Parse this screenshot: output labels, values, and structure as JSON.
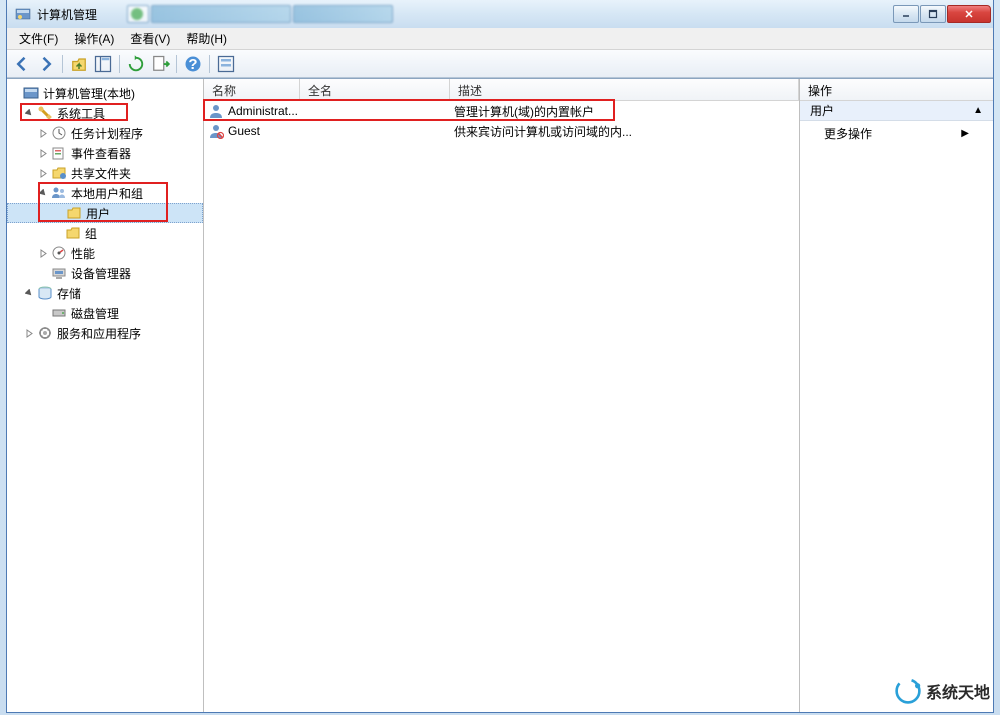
{
  "window": {
    "title": "计算机管理"
  },
  "menubar": [
    {
      "label": "文件(F)"
    },
    {
      "label": "操作(A)"
    },
    {
      "label": "查看(V)"
    },
    {
      "label": "帮助(H)"
    }
  ],
  "tree": {
    "root": "计算机管理(本地)",
    "system_tools": "系统工具",
    "task_scheduler": "任务计划程序",
    "event_viewer": "事件查看器",
    "shared_folders": "共享文件夹",
    "local_users_groups": "本地用户和组",
    "users": "用户",
    "groups": "组",
    "performance": "性能",
    "device_manager": "设备管理器",
    "storage": "存储",
    "disk_management": "磁盘管理",
    "services_apps": "服务和应用程序"
  },
  "list": {
    "headers": {
      "name": "名称",
      "fullname": "全名",
      "description": "描述"
    },
    "rows": [
      {
        "name": "Administrat...",
        "fullname": "",
        "description": "管理计算机(域)的内置帐户"
      },
      {
        "name": "Guest",
        "fullname": "",
        "description": "供来宾访问计算机或访问域的内..."
      }
    ]
  },
  "actions": {
    "header": "操作",
    "section": "用户",
    "more": "更多操作"
  },
  "watermark": "系统天地"
}
